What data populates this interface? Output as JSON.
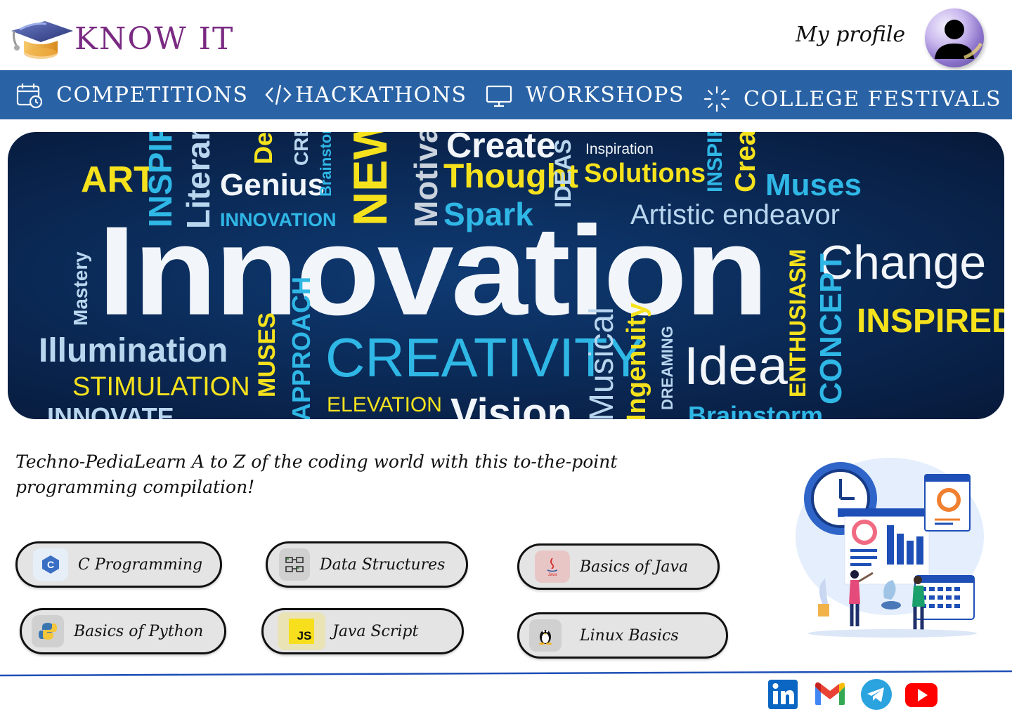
{
  "app": {
    "brand": "KNOW IT",
    "brand_color": "#7a2a82"
  },
  "header": {
    "profile_label": "My profile"
  },
  "nav": {
    "background": "#2a63a5",
    "items": [
      {
        "label": "COMPETITIONS",
        "icon": "calendar-clock-icon"
      },
      {
        "label": "HACKATHONS",
        "icon": "code-icon"
      },
      {
        "label": "WORKSHOPS",
        "icon": "monitor-icon"
      },
      {
        "label": "COLLEGE FESTIVALS",
        "icon": "sparkle-icon"
      }
    ]
  },
  "banner": {
    "main_word": "Innovation",
    "words": [
      "ART",
      "INSPIRE",
      "Literary",
      "Genius",
      "INNOVATION",
      "Design",
      "CREATE",
      "Brainstorm",
      "NEW",
      "Motivation",
      "Create",
      "Thought",
      "Spark",
      "IDEAS",
      "Inspiration",
      "Solutions",
      "INSPIRE",
      "Creativity",
      "Muses",
      "Artistic endeavor",
      "Mastery",
      "Change",
      "ENTHUSIASM",
      "INSPIRED",
      "CONCEPT",
      "Illumination",
      "STIMULATION",
      "MUSES",
      "APPROACH",
      "CREATIVITY",
      "ELEVATION",
      "Musical",
      "Ingenuity",
      "DREAMING",
      "Idea",
      "INNOVATE",
      "Vision",
      "Brainstorm"
    ]
  },
  "description": "Techno-PediaLearn A to Z of the coding world with this to-the-point programming compilation!",
  "courses": [
    {
      "label": "C Programming",
      "icon": "c-language-icon"
    },
    {
      "label": "Data Structures",
      "icon": "data-structure-icon"
    },
    {
      "label": "Basics of Java",
      "icon": "java-icon"
    },
    {
      "label": "Basics of Python",
      "icon": "python-icon"
    },
    {
      "label": "Java Script",
      "icon": "javascript-icon"
    },
    {
      "label": "Linux  Basics",
      "icon": "linux-icon"
    }
  ],
  "footer": {
    "social": [
      {
        "name": "linkedin",
        "icon": "linkedin-icon",
        "color": "#0a66c2"
      },
      {
        "name": "gmail",
        "icon": "gmail-icon",
        "color": "#ea4335"
      },
      {
        "name": "telegram",
        "icon": "telegram-icon",
        "color": "#2aa3df"
      },
      {
        "name": "youtube",
        "icon": "youtube-icon",
        "color": "#ff0000"
      }
    ]
  }
}
